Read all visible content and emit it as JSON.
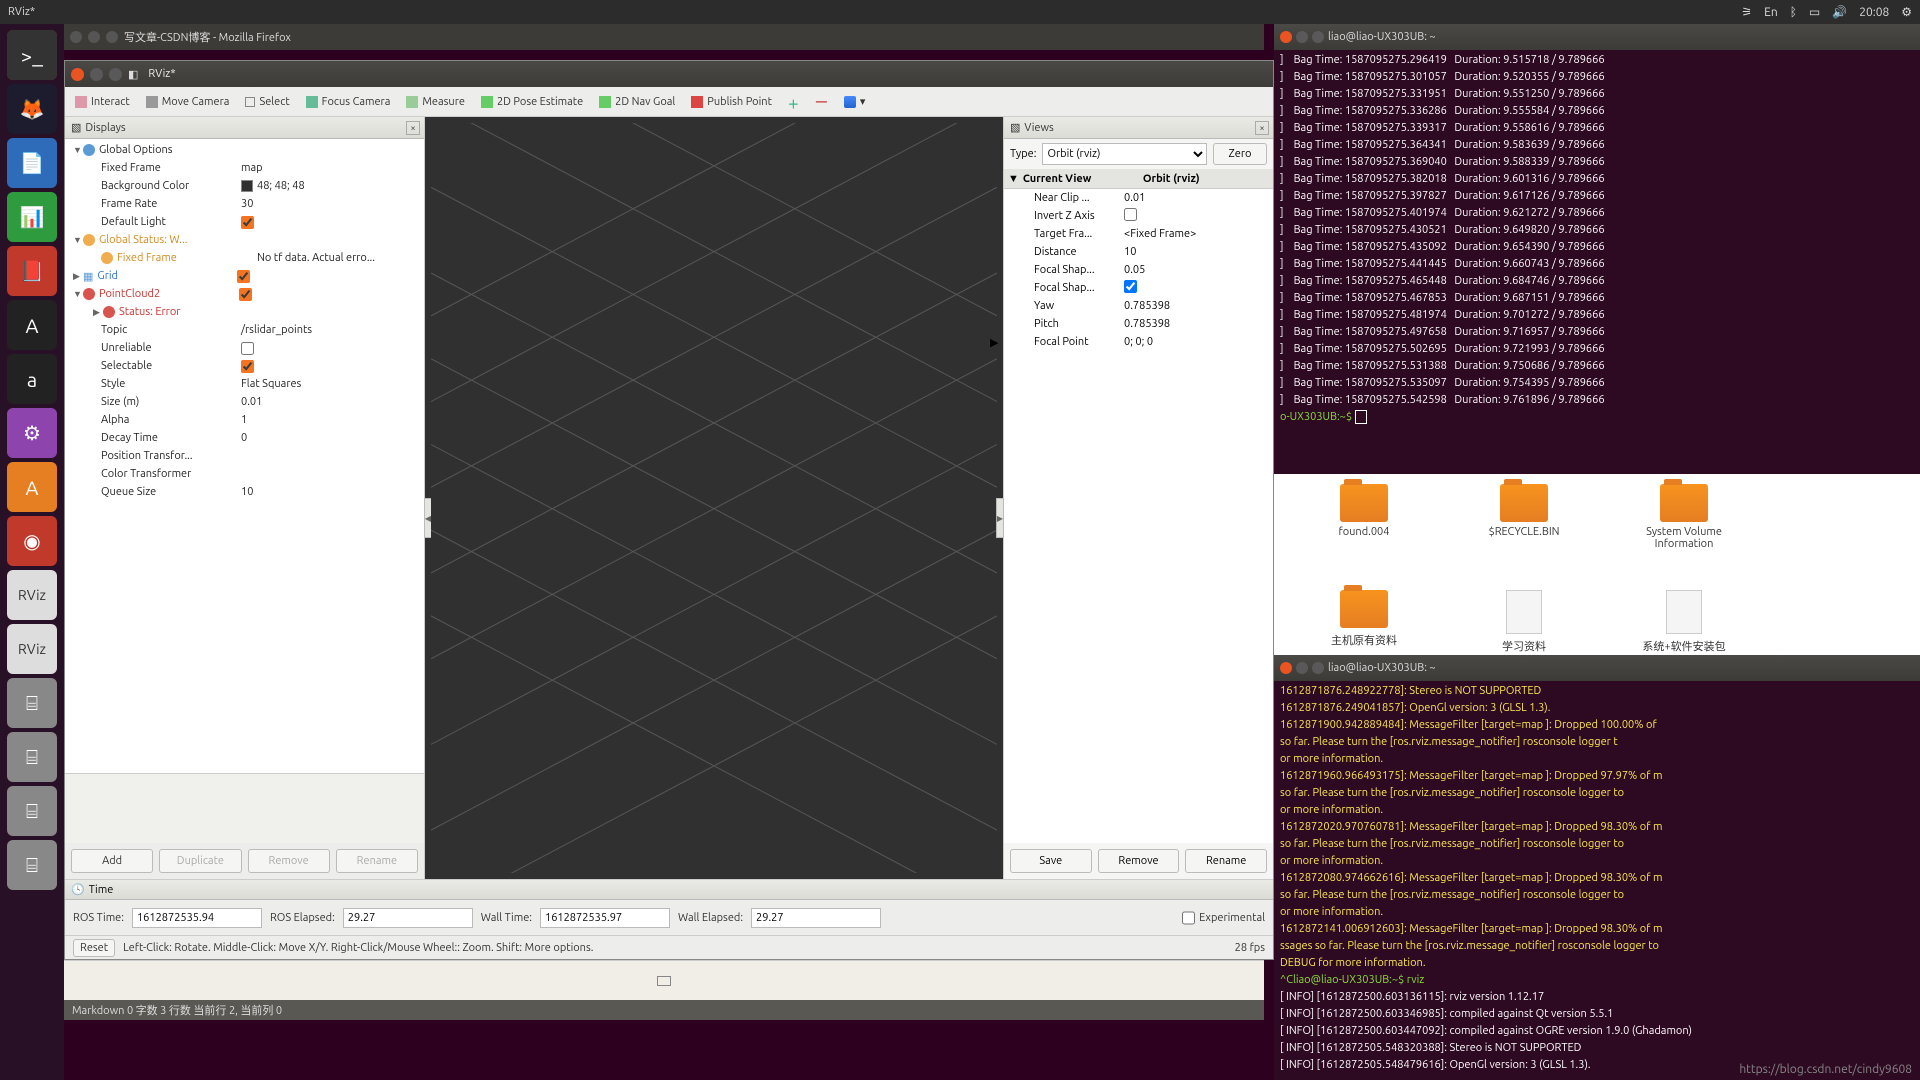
{
  "topbar": {
    "title": "RViz*",
    "clock": "20:08",
    "lang": "En"
  },
  "launcher_hint": "",
  "firefox": {
    "title": "写文章-CSDN博客 - Mozilla Firefox"
  },
  "rviz": {
    "title": "RViz*",
    "tools": {
      "interact": "Interact",
      "move_camera": "Move Camera",
      "select": "Select",
      "focus_camera": "Focus Camera",
      "measure": "Measure",
      "pose": "2D Pose Estimate",
      "nav": "2D Nav Goal",
      "publish": "Publish Point"
    },
    "displays_label": "Displays",
    "tree": {
      "global_options": "Global Options",
      "fixed_frame_lbl": "Fixed Frame",
      "fixed_frame_val": "map",
      "bg_lbl": "Background Color",
      "bg_val": "48; 48; 48",
      "fr_lbl": "Frame Rate",
      "fr_val": "30",
      "dl_lbl": "Default Light",
      "gstatus": "Global Status: W...",
      "gstatus_ff": "Fixed Frame",
      "gstatus_ff_val": "No tf data.  Actual erro...",
      "grid": "Grid",
      "pc2": "PointCloud2",
      "pc2_status": "Status: Error",
      "topic_lbl": "Topic",
      "topic_val": "/rslidar_points",
      "unrel_lbl": "Unreliable",
      "sel_lbl": "Selectable",
      "style_lbl": "Style",
      "style_val": "Flat Squares",
      "size_lbl": "Size (m)",
      "size_val": "0.01",
      "alpha_lbl": "Alpha",
      "alpha_val": "1",
      "decay_lbl": "Decay Time",
      "decay_val": "0",
      "ptr_lbl": "Position Transfor...",
      "ctr_lbl": "Color Transformer",
      "qs_lbl": "Queue Size",
      "qs_val": "10"
    },
    "disp_btns": {
      "add": "Add",
      "dup": "Duplicate",
      "rem": "Remove",
      "ren": "Rename"
    },
    "views": {
      "label": "Views",
      "type_lbl": "Type:",
      "type_val": "Orbit (rviz)",
      "zero": "Zero",
      "cv": "Current View",
      "cv_val": "Orbit (rviz)",
      "near": "Near Clip ...",
      "near_v": "0.01",
      "invz": "Invert Z Axis",
      "tf": "Target Fra...",
      "tf_v": "<Fixed Frame>",
      "dist": "Distance",
      "dist_v": "10",
      "fss": "Focal Shap...",
      "fss_v": "0.05",
      "fsf": "Focal Shap...",
      "yaw": "Yaw",
      "yaw_v": "0.785398",
      "pitch": "Pitch",
      "pitch_v": "0.785398",
      "fp": "Focal Point",
      "fp_v": "0; 0; 0",
      "save": "Save",
      "remove": "Remove",
      "rename": "Rename"
    },
    "time": {
      "label": "Time",
      "rt": "ROS Time:",
      "rt_v": "1612872535.94",
      "re": "ROS Elapsed:",
      "re_v": "29.27",
      "wt": "Wall Time:",
      "wt_v": "1612872535.97",
      "we": "Wall Elapsed:",
      "we_v": "29.27",
      "exp": "Experimental"
    },
    "status": {
      "reset": "Reset",
      "hint": "Left-Click: Rotate.  Middle-Click: Move X/Y.  Right-Click/Mouse Wheel:: Zoom.  Shift: More options.",
      "fps": "28 fps"
    }
  },
  "bottom_status": "Markdown   0 字数   3 行数   当前行 2, 当前列 0",
  "term1": {
    "title": "liao@liao-UX303UB: ~",
    "lines": [
      "]    Bag Time: 1587095275.296419   Duration: 9.515718 / 9.789666",
      "]    Bag Time: 1587095275.301057   Duration: 9.520355 / 9.789666",
      "]    Bag Time: 1587095275.331951   Duration: 9.551250 / 9.789666",
      "]    Bag Time: 1587095275.336286   Duration: 9.555584 / 9.789666",
      "]    Bag Time: 1587095275.339317   Duration: 9.558616 / 9.789666",
      "]    Bag Time: 1587095275.364341   Duration: 9.583639 / 9.789666",
      "]    Bag Time: 1587095275.369040   Duration: 9.588339 / 9.789666",
      "]    Bag Time: 1587095275.382018   Duration: 9.601316 / 9.789666",
      "]    Bag Time: 1587095275.397827   Duration: 9.617126 / 9.789666",
      "]    Bag Time: 1587095275.401974   Duration: 9.621272 / 9.789666",
      "]    Bag Time: 1587095275.430521   Duration: 9.649820 / 9.789666",
      "]    Bag Time: 1587095275.435092   Duration: 9.654390 / 9.789666",
      "]    Bag Time: 1587095275.441445   Duration: 9.660743 / 9.789666",
      "]    Bag Time: 1587095275.465448   Duration: 9.684746 / 9.789666",
      "]    Bag Time: 1587095275.467853   Duration: 9.687151 / 9.789666",
      "]    Bag Time: 1587095275.481974   Duration: 9.701272 / 9.789666",
      "]    Bag Time: 1587095275.497658   Duration: 9.716957 / 9.789666",
      "]    Bag Time: 1587095275.502695   Duration: 9.721993 / 9.789666",
      "]    Bag Time: 1587095275.531388   Duration: 9.750686 / 9.789666",
      "]    Bag Time: 1587095275.535097   Duration: 9.754395 / 9.789666",
      "]    Bag Time: 1587095275.542598   Duration: 9.761896 / 9.789666"
    ],
    "prompt": "o-UX303UB:~$ "
  },
  "files": {
    "f1": "found.004",
    "f2": "$RECYCLE.BIN",
    "f3": "System Volume Information",
    "f4": "主机原有资料",
    "f5": "学习资料",
    "f6": "系统+软件安装包"
  },
  "term2": {
    "title": "liao@liao-UX303UB: ~",
    "body": "1612871876.248922778]: Stereo is NOT SUPPORTED\n1612871876.249041857]: OpenGl version: 3 (GLSL 1.3).\n1612871900.942889484]: MessageFilter [target=map ]: Dropped 100.00% of \nso far. Please turn the [ros.rviz.message_notifier] rosconsole logger t\nor more information.\n1612871960.966493175]: MessageFilter [target=map ]: Dropped 97.97% of m\nso far. Please turn the [ros.rviz.message_notifier] rosconsole logger to\nor more information.\n1612872020.970760781]: MessageFilter [target=map ]: Dropped 98.30% of m\nso far. Please turn the [ros.rviz.message_notifier] rosconsole logger to\nor more information.\n1612872080.974662616]: MessageFilter [target=map ]: Dropped 98.30% of m\nso far. Please turn the [ros.rviz.message_notifier] rosconsole logger to\nor more information.\n1612872141.006912603]: MessageFilter [target=map ]: Dropped 98.30% of m\nssages so far. Please turn the [ros.rviz.message_notifier] rosconsole logger to\nDEBUG for more information.",
    "prompt": "^Cliao@liao-UX303UB:~$ rviz",
    "info": "[ INFO] [1612872500.603136115]: rviz version 1.12.17\n[ INFO] [1612872500.603346985]: compiled against Qt version 5.5.1\n[ INFO] [1612872500.603447092]: compiled against OGRE version 1.9.0 (Ghadamon)\n[ INFO] [1612872505.548320388]: Stereo is NOT SUPPORTED\n[ INFO] [1612872505.548479616]: OpenGl version: 3 (GLSL 1.3)."
  },
  "watermark": "https://blog.csdn.net/cindy9608"
}
